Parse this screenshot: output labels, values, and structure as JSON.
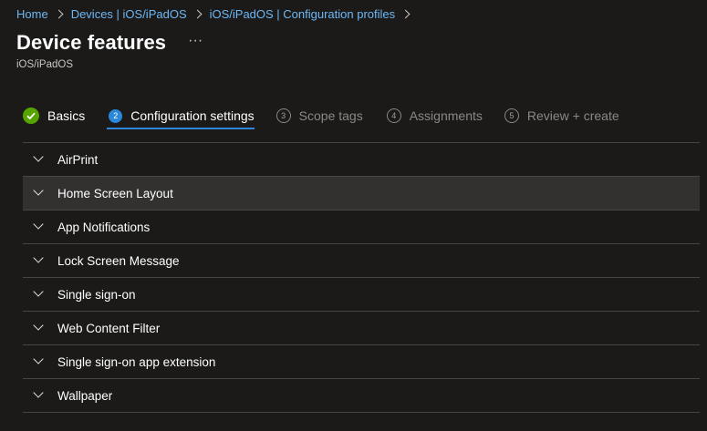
{
  "breadcrumb": {
    "items": [
      {
        "label": "Home"
      },
      {
        "label": "Devices | iOS/iPadOS"
      },
      {
        "label": "iOS/iPadOS | Configuration profiles"
      }
    ]
  },
  "header": {
    "title": "Device features",
    "more_label": "···",
    "subtitle": "iOS/iPadOS"
  },
  "wizard": {
    "steps": [
      {
        "number": "",
        "label": "Basics",
        "state": "done"
      },
      {
        "number": "2",
        "label": "Configuration settings",
        "state": "current"
      },
      {
        "number": "3",
        "label": "Scope tags",
        "state": "pending"
      },
      {
        "number": "4",
        "label": "Assignments",
        "state": "pending"
      },
      {
        "number": "5",
        "label": "Review + create",
        "state": "pending"
      }
    ]
  },
  "sections": [
    {
      "label": "AirPrint"
    },
    {
      "label": "Home Screen Layout"
    },
    {
      "label": "App Notifications"
    },
    {
      "label": "Lock Screen Message"
    },
    {
      "label": "Single sign-on"
    },
    {
      "label": "Web Content Filter"
    },
    {
      "label": "Single sign-on app extension"
    },
    {
      "label": "Wallpaper"
    }
  ],
  "colors": {
    "background": "#1b1a19",
    "link": "#6cb8f6",
    "accent": "#2b88d8",
    "success": "#57a300",
    "divider": "#484644",
    "hover_row": "#323130"
  }
}
